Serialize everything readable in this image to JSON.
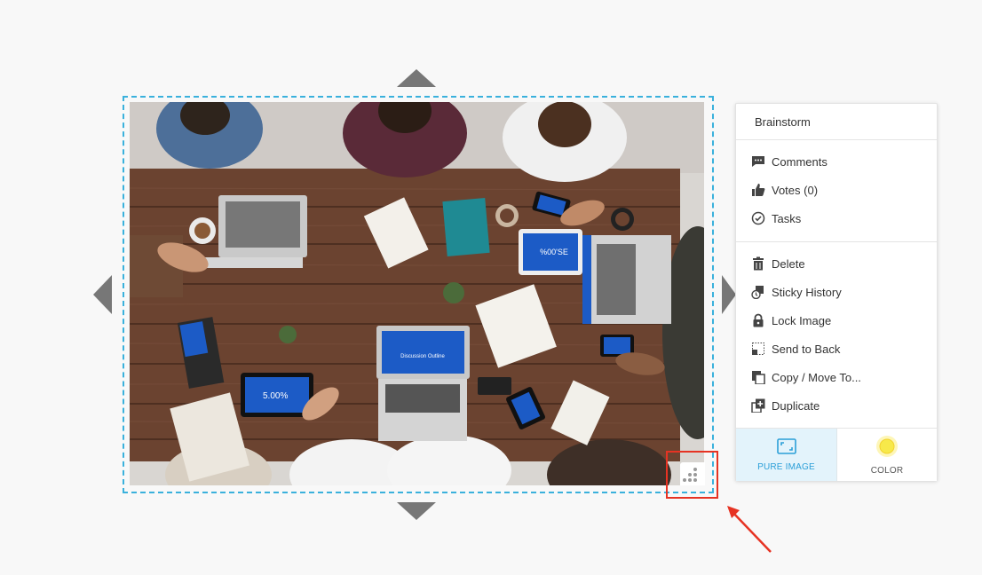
{
  "menu": {
    "title": "Brainstorm",
    "items_group1": [
      {
        "label": "Comments",
        "icon": "comment-icon"
      },
      {
        "label": "Votes (0)",
        "icon": "thumbs-up-icon"
      },
      {
        "label": "Tasks",
        "icon": "check-circle-icon"
      }
    ],
    "items_group2": [
      {
        "label": "Delete",
        "icon": "trash-icon"
      },
      {
        "label": "Sticky History",
        "icon": "history-icon"
      },
      {
        "label": "Lock Image",
        "icon": "lock-icon"
      },
      {
        "label": "Send to Back",
        "icon": "send-to-back-icon"
      },
      {
        "label": "Copy / Move To...",
        "icon": "copy-icon"
      },
      {
        "label": "Duplicate",
        "icon": "duplicate-icon"
      }
    ],
    "tabs": {
      "pure_image": "PURE IMAGE",
      "color": "COLOR"
    }
  },
  "colors": {
    "selection_border": "#3ab1dc",
    "highlight": "#e63323",
    "active_tab_bg": "#e3f3fb",
    "active_tab_text": "#2b9fd8",
    "color_swatch": "#f7e94a"
  },
  "image": {
    "screen_text_1": "%00'SE",
    "screen_text_2": "5.00%",
    "screen_text_3": "Discussion Outline"
  }
}
